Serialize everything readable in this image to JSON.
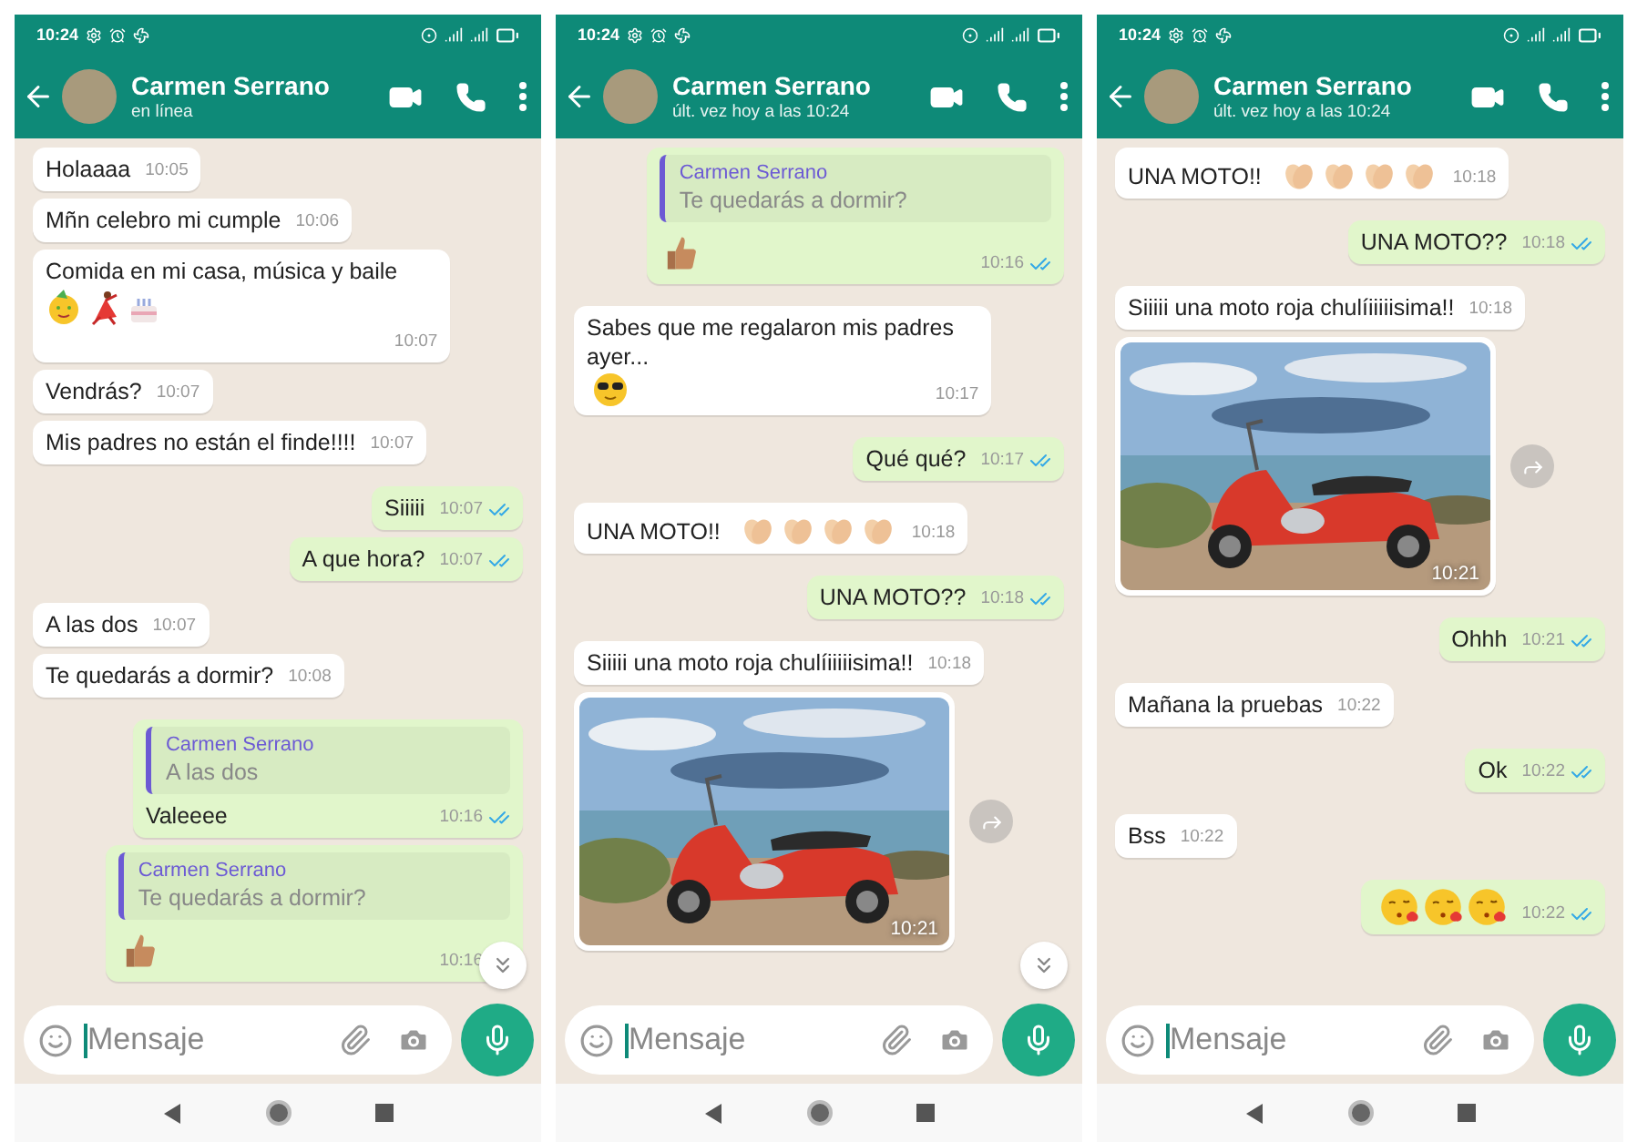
{
  "phones": [
    {
      "status_time": "10:24",
      "contact": {
        "name": "Carmen Serrano",
        "status": "en línea"
      },
      "scroll_button": true,
      "placeholder": "Mensaje",
      "messages": [
        {
          "kind": "text",
          "outgoing": false,
          "text": "Holaaaa",
          "time": "10:05"
        },
        {
          "kind": "text",
          "outgoing": false,
          "text": "Mñn celebro mi cumple",
          "time": "10:06"
        },
        {
          "kind": "text",
          "outgoing": false,
          "text": "Comida en mi casa, música y baile",
          "stickers": [
            {
              "kind": "party-face"
            },
            {
              "kind": "dancer"
            },
            {
              "kind": "cake"
            }
          ],
          "time": "10:07"
        },
        {
          "kind": "text",
          "outgoing": false,
          "text": "Vendrás?",
          "time": "10:07"
        },
        {
          "kind": "text",
          "outgoing": false,
          "text": "Mis padres no están el finde!!!!",
          "time": "10:07"
        },
        {
          "kind": "text",
          "outgoing": true,
          "text": "Siiiii",
          "time": "10:07",
          "read": true
        },
        {
          "kind": "text",
          "outgoing": true,
          "text": "A que hora?",
          "time": "10:07",
          "read": true
        },
        {
          "kind": "text",
          "outgoing": false,
          "text": "A las dos",
          "time": "10:07"
        },
        {
          "kind": "text",
          "outgoing": false,
          "text": "Te quedarás a dormir?",
          "time": "10:08"
        },
        {
          "kind": "text",
          "outgoing": true,
          "quote": {
            "author": "Carmen Serrano",
            "text": "A las dos"
          },
          "text": "Valeeee",
          "time": "10:16",
          "read": true
        },
        {
          "kind": "text",
          "outgoing": true,
          "quote": {
            "author": "Carmen Serrano",
            "text": "Te quedarás a dormir?"
          },
          "stickers": [
            {
              "kind": "thumbs-up"
            }
          ],
          "time": "10:16"
        }
      ]
    },
    {
      "status_time": "10:24",
      "contact": {
        "name": "Carmen Serrano",
        "status": "últ. vez hoy a las 10:24"
      },
      "scroll_button": true,
      "placeholder": "Mensaje",
      "messages": [
        {
          "kind": "text",
          "outgoing": true,
          "quote": {
            "author": "Carmen Serrano",
            "text": "Te quedarás a dormir?"
          },
          "stickers": [
            {
              "kind": "thumbs-up"
            }
          ],
          "time": "10:16",
          "read": true
        },
        {
          "kind": "text",
          "outgoing": false,
          "text": "Sabes que me regalaron mis padres ayer...",
          "stickers": [
            {
              "kind": "cool-face"
            }
          ],
          "time": "10:17"
        },
        {
          "kind": "text",
          "outgoing": true,
          "text": "Qué qué?",
          "time": "10:17",
          "read": true
        },
        {
          "kind": "text",
          "outgoing": false,
          "text": "UNA MOTO!!",
          "stickers": [
            {
              "kind": "clap"
            },
            {
              "kind": "clap"
            },
            {
              "kind": "clap"
            },
            {
              "kind": "clap"
            }
          ],
          "time": "10:18"
        },
        {
          "kind": "text",
          "outgoing": true,
          "text": "UNA MOTO??",
          "time": "10:18",
          "read": true
        },
        {
          "kind": "text",
          "outgoing": false,
          "text": "Siiiii una moto roja chulíiiiiisima!!",
          "time": "10:18"
        },
        {
          "outgoing": false,
          "time": "10:21"
        }
      ]
    },
    {
      "status_time": "10:24",
      "contact": {
        "name": "Carmen Serrano",
        "status": "últ. vez hoy a las 10:24"
      },
      "scroll_button": false,
      "placeholder": "Mensaje",
      "messages": [
        {
          "kind": "text",
          "outgoing": false,
          "text": "UNA MOTO!!",
          "stickers": [
            {
              "kind": "clap"
            },
            {
              "kind": "clap"
            },
            {
              "kind": "clap"
            },
            {
              "kind": "clap"
            }
          ],
          "time": "10:18"
        },
        {
          "kind": "text",
          "outgoing": true,
          "text": "UNA MOTO??",
          "time": "10:18",
          "read": true
        },
        {
          "kind": "text",
          "outgoing": false,
          "text": "Siiiii una moto roja chulíiiiiisima!!",
          "time": "10:18"
        },
        {
          "outgoing": false,
          "time": "10:21"
        },
        {
          "kind": "text",
          "outgoing": true,
          "text": "Ohhh",
          "time": "10:21",
          "read": true
        },
        {
          "kind": "text",
          "outgoing": false,
          "text": "Mañana la pruebas",
          "time": "10:22"
        },
        {
          "kind": "text",
          "outgoing": true,
          "text": "Ok",
          "time": "10:22",
          "read": true
        },
        {
          "kind": "text",
          "outgoing": false,
          "text": "Bss",
          "time": "10:22"
        },
        {
          "kind": "text",
          "outgoing": true,
          "stickers": [
            {
              "kind": "kiss-face"
            },
            {
              "kind": "kiss-face"
            },
            {
              "kind": "kiss-face"
            }
          ],
          "time": "10:22",
          "read": true
        }
      ]
    }
  ]
}
